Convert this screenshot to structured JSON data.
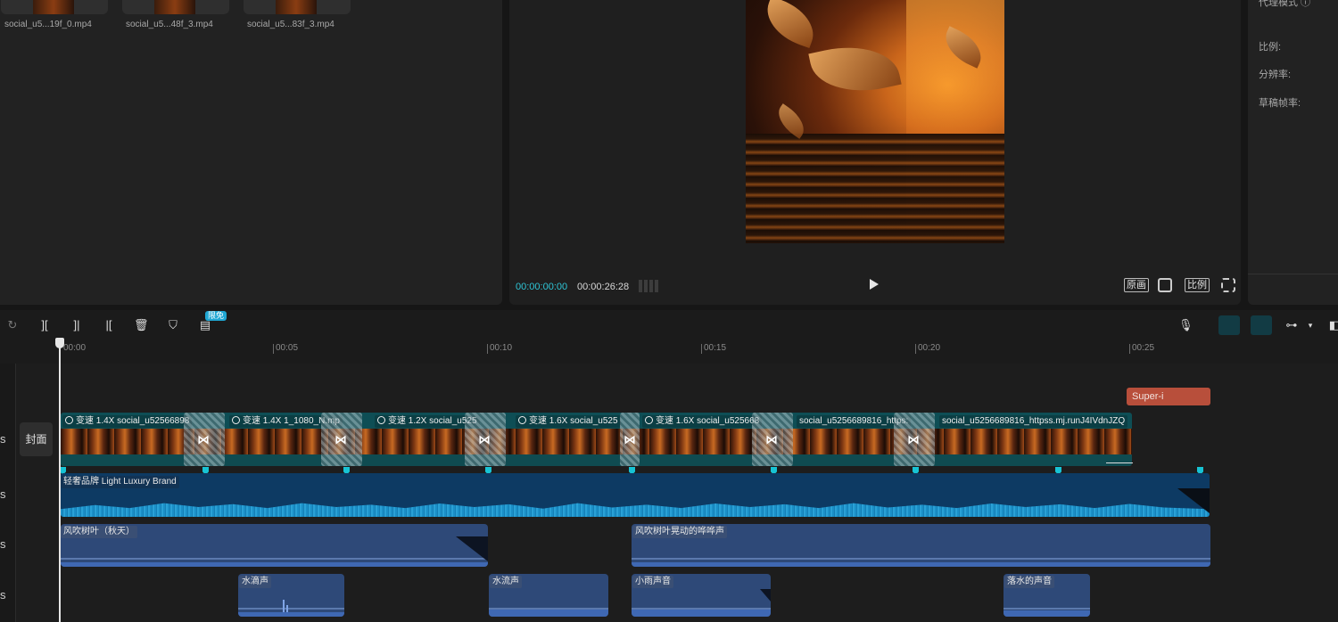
{
  "media": {
    "items": [
      {
        "name": "social_u5...19f_0.mp4"
      },
      {
        "name": "social_u5...48f_3.mp4"
      },
      {
        "name": "social_u5...83f_3.mp4"
      }
    ]
  },
  "player": {
    "current_time": "00:00:00:00",
    "total_time": "00:00:26:28",
    "btn_original": "原画",
    "btn_ratio": "比例"
  },
  "properties": {
    "proxy_mode": "代理模式 ⓘ",
    "ratio_label": "比例:",
    "resolution_label": "分辨率:",
    "framerate_label": "草稿帧率:"
  },
  "toolbar": {
    "badge": "限免",
    "icons": [
      "redo-icon",
      "split-icon",
      "split-left-icon",
      "split-right-icon",
      "delete-icon",
      "shield-icon",
      "caption-icon"
    ]
  },
  "ruler": {
    "labels": [
      "00:00",
      "00:05",
      "00:10",
      "00:15",
      "00:20",
      "00:25"
    ]
  },
  "timeline": {
    "track_letter": "s",
    "cover_label": "封面",
    "text_clip": "Super-i",
    "video_clips": [
      {
        "speed": "变速 1.4X",
        "name": "social_u52566898"
      },
      {
        "speed": "变速 1.4X",
        "name": "1_1080_N.mp"
      },
      {
        "speed": "变速 1.2X",
        "name": "social_u525"
      },
      {
        "speed": "变速 1.6X",
        "name": "social_u525"
      },
      {
        "speed": "变速 1.6X",
        "name": "social_u525668"
      },
      {
        "speed": "",
        "name": "social_u5256689816_https:"
      },
      {
        "speed": "",
        "name": "social_u5256689816_httpss.mj.runJ4IVdnJZQ"
      }
    ],
    "music_label": "轻奢品牌 Light Luxury Brand",
    "sfx_row1": [
      "风吹树叶（秋天）",
      "风吹树叶晃动的哗哗声"
    ],
    "sfx_row2": [
      "水滴声",
      "水流声",
      "小雨声音",
      "落水的声音"
    ]
  },
  "colors": {
    "accent": "#2fc5d6",
    "video_track": "#0e4e55",
    "music_track": "#0d3a63",
    "sfx_track": "#2e4978",
    "text_clip": "#b84f3b"
  }
}
